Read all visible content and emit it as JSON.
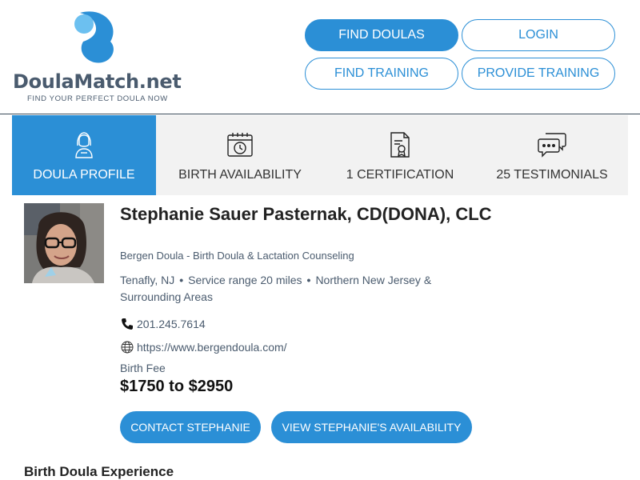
{
  "brand": {
    "name_main": "DoulaMatch",
    "name_suffix": ".net",
    "tagline": "FIND YOUR PERFECT DOULA NOW",
    "accent_color": "#2b8fd6",
    "logo_light_color": "#6cc0f0"
  },
  "nav": {
    "find_doulas": "FIND DOULAS",
    "login": "LOGIN",
    "find_training": "FIND TRAINING",
    "provide_training": "PROVIDE TRAINING"
  },
  "tabs": [
    {
      "label": "DOULA PROFILE",
      "icon": "doula-person-icon",
      "active": true
    },
    {
      "label": "BIRTH AVAILABILITY",
      "icon": "calendar-clock-icon",
      "active": false
    },
    {
      "label": "1 CERTIFICATION",
      "icon": "certificate-icon",
      "active": false
    },
    {
      "label": "25 TESTIMONIALS",
      "icon": "chat-bubbles-icon",
      "active": false
    }
  ],
  "profile": {
    "name": "Stephanie Sauer Pasternak, CD(DONA), CLC",
    "business": "Bergen Doula - Birth Doula & Lactation Counseling",
    "city": "Tenafly, NJ",
    "service_range": "Service range 20 miles",
    "region": "Northern New Jersey & Surrounding Areas",
    "phone": "201.245.7614",
    "website": "https://www.bergendoula.com/",
    "fee_label": "Birth Fee",
    "fee_value": "$1750 to $2950"
  },
  "actions": {
    "contact": "CONTACT STEPHANIE",
    "view_availability": "VIEW STEPHANIE'S AVAILABILITY"
  },
  "sections": {
    "experience_title": "Birth Doula Experience"
  }
}
